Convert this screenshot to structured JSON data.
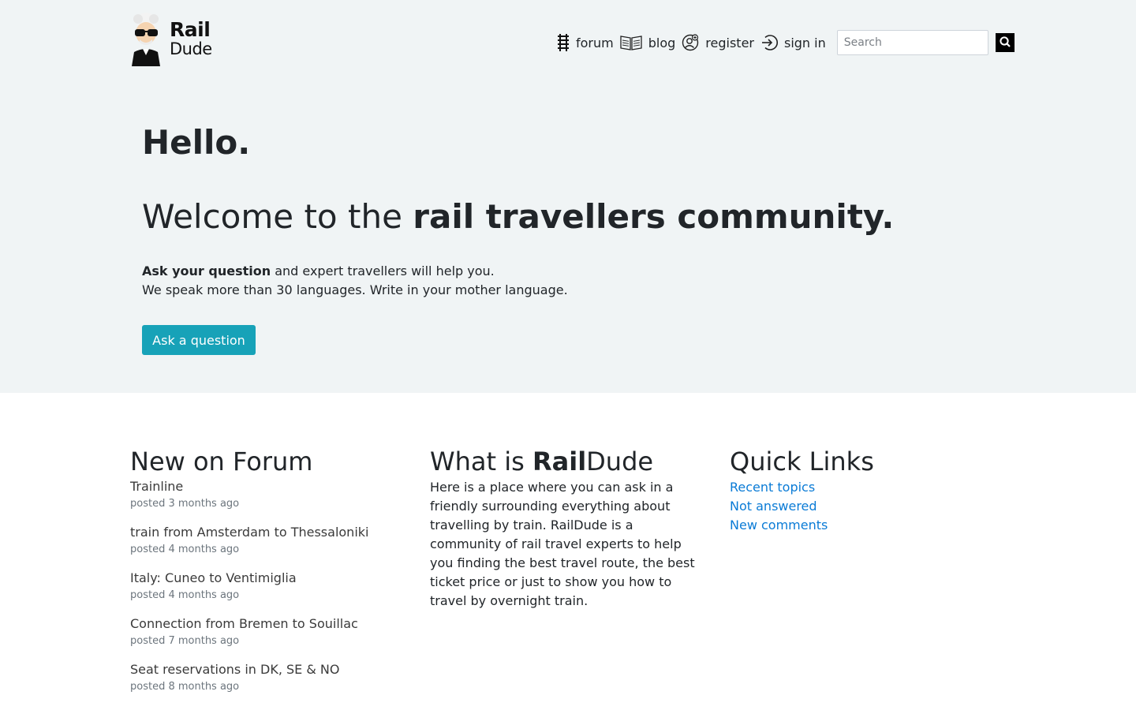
{
  "brand": {
    "line1": "Rail",
    "line2": "Dude"
  },
  "nav": {
    "forum": "forum",
    "blog": "blog",
    "register": "register",
    "signin": "sign in",
    "search_placeholder": "Search"
  },
  "hero": {
    "hello": "Hello.",
    "welcome_prefix": "Welcome to the ",
    "welcome_bold": "rail travellers community.",
    "intro_bold": "Ask your question",
    "intro_rest": " and expert travellers will help you.",
    "intro_line2": "We speak more than 30 languages. Write in your mother language.",
    "button": "Ask a question"
  },
  "forum": {
    "heading": "New on Forum",
    "topics": [
      {
        "title": "Trainline",
        "meta": "posted 3 months ago"
      },
      {
        "title": "train from Amsterdam to Thessaloniki",
        "meta": "posted 4 months ago"
      },
      {
        "title": "Italy: Cuneo to Ventimiglia",
        "meta": "posted 4 months ago"
      },
      {
        "title": "Connection from Bremen to Souillac",
        "meta": "posted 7 months ago"
      },
      {
        "title": "Seat reservations in DK, SE & NO",
        "meta": "posted 8 months ago"
      }
    ]
  },
  "what": {
    "heading_prefix": "What is ",
    "heading_bold": "Rail",
    "heading_suffix": "Dude",
    "text": "Here is a place where you can ask in a friendly surrounding everything about travelling by train. RailDude is a community of rail travel experts to help you finding the best travel route, the best ticket price or just to show you how to travel by overnight train."
  },
  "quick_links": {
    "heading": "Quick Links",
    "links": [
      "Recent topics",
      "Not answered",
      "New comments"
    ]
  },
  "colors": {
    "hero_bg": "#f0f4f5",
    "button": "#17a2b8",
    "link": "#0a7bd6"
  },
  "icons": [
    "railway-icon",
    "book-icon",
    "user-add-icon",
    "sign-in-icon",
    "search-icon"
  ]
}
